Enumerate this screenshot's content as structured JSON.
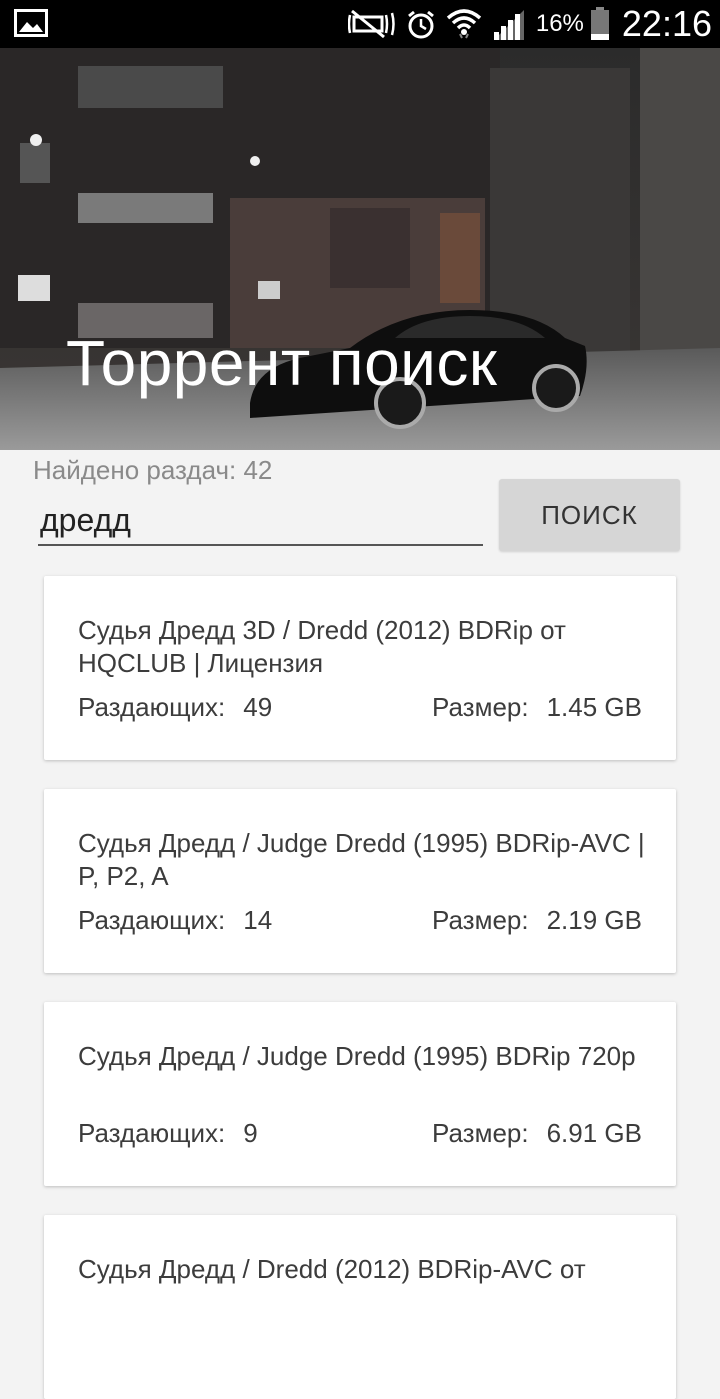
{
  "status_bar": {
    "battery": "16%",
    "time": "22:16",
    "icons": [
      "gallery-icon",
      "mute-icon",
      "alarm-icon",
      "wifi-icon",
      "signal-icon",
      "battery-icon"
    ]
  },
  "header": {
    "title": "Торрент поиск"
  },
  "search": {
    "found_label": "Найдено раздач: 42",
    "query": "дредд",
    "button_label": "ПОИСК"
  },
  "results": [
    {
      "title": "Судья Дредд 3D / Dredd (2012) BDRip от HQCLUB | Лицензия",
      "seeders_label": "Раздающих:",
      "seeders": "49",
      "size_label": "Размер:",
      "size": "1.45 GB"
    },
    {
      "title": "Судья Дредд / Judge Dredd (1995) BDRip-AVC | P, P2, A",
      "seeders_label": "Раздающих:",
      "seeders": "14",
      "size_label": "Размер:",
      "size": "2.19 GB"
    },
    {
      "title": "Судья Дредд / Judge Dredd (1995) BDRip 720p",
      "seeders_label": "Раздающих:",
      "seeders": "9",
      "size_label": "Размер:",
      "size": "6.91 GB"
    },
    {
      "title": "Судья Дредд / Dredd (2012) BDRip-AVC от",
      "seeders_label": "",
      "seeders": "",
      "size_label": "",
      "size": ""
    }
  ]
}
